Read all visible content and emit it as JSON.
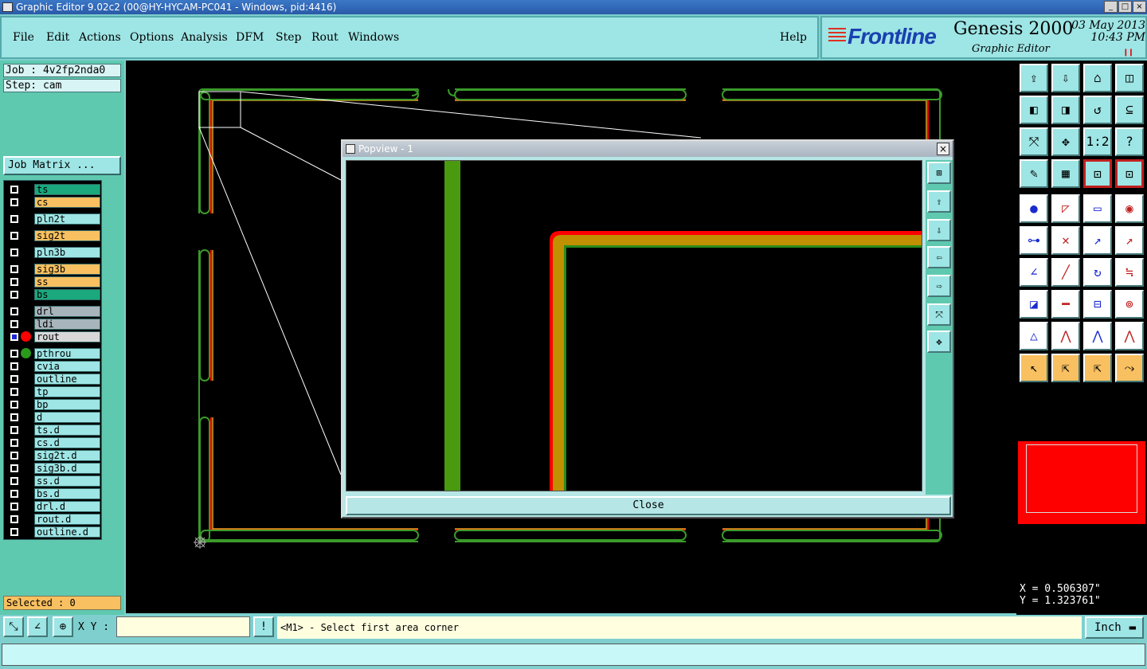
{
  "window": {
    "title": "Graphic Editor 9.02c2 (00@HY-HYCAM-PC041 - Windows, pid:4416)"
  },
  "menu": [
    "File",
    "Edit",
    "Actions",
    "Options",
    "Analysis",
    "DFM",
    "Step",
    "Rout",
    "Windows"
  ],
  "help": "Help",
  "brand": {
    "logo": "Frontline",
    "product": "Genesis 2000",
    "subtitle": "Graphic Editor",
    "date": "03 May 2013",
    "time": "10:43 PM",
    "pause": "❙❙"
  },
  "job": "Job : 4v2fp2nda0",
  "step": "Step: cam",
  "job_matrix": "Job Matrix ...",
  "layers": [
    {
      "name": "ts",
      "color": "#1aa87c"
    },
    {
      "name": "cs",
      "color": "#f8c060"
    },
    {
      "name": "pln2t",
      "color": "#9ee5e5"
    },
    {
      "name": "sig2t",
      "color": "#f8c060"
    },
    {
      "name": "pln3b",
      "color": "#9ee5e5"
    },
    {
      "name": "sig3b",
      "color": "#f8c060"
    },
    {
      "name": "ss",
      "color": "#f8c060"
    },
    {
      "name": "bs",
      "color": "#1aa87c"
    },
    {
      "name": "drl",
      "color": "#a8b4bc"
    },
    {
      "name": "ldi",
      "color": "#a8b4bc"
    },
    {
      "name": "rout",
      "color": "#d8d8d8",
      "dot": "#ff0000",
      "active": true
    },
    {
      "name": "pthrou",
      "color": "#9ee5e5",
      "dot": "#2a9a1a"
    },
    {
      "name": "cvia",
      "color": "#9ee5e5"
    },
    {
      "name": "outline",
      "color": "#9ee5e5"
    },
    {
      "name": "tp",
      "color": "#9ee5e5"
    },
    {
      "name": "bp",
      "color": "#9ee5e5"
    },
    {
      "name": "d",
      "color": "#9ee5e5"
    },
    {
      "name": "ts.d",
      "color": "#9ee5e5"
    },
    {
      "name": "cs.d",
      "color": "#9ee5e5"
    },
    {
      "name": "sig2t.d",
      "color": "#9ee5e5"
    },
    {
      "name": "sig3b.d",
      "color": "#9ee5e5"
    },
    {
      "name": "ss.d",
      "color": "#9ee5e5"
    },
    {
      "name": "bs.d",
      "color": "#9ee5e5"
    },
    {
      "name": "drl.d",
      "color": "#9ee5e5"
    },
    {
      "name": "rout.d",
      "color": "#9ee5e5"
    },
    {
      "name": "outline.d",
      "color": "#9ee5e5"
    }
  ],
  "selected": "Selected : 0",
  "popup": {
    "title": "Popview - 1",
    "close": "Close"
  },
  "coords": {
    "x": "X = 0.506307\"",
    "y": "Y = 1.323761\""
  },
  "xy_label": "X Y :",
  "prompt": "<M1> - Select first area corner",
  "unit": "Inch",
  "tool_icons": [
    "zoom-home-icon",
    "zoom-out-icon",
    "home-icon",
    "window-icon",
    "pan-left-icon",
    "pan-right-icon",
    "undo-icon",
    "redraw-icon",
    "fit-icon",
    "center-icon",
    "scale-1-2-icon",
    "help-icon",
    "measure-tool-icon",
    "grid-icon",
    "snap-icon",
    "snap-red-icon",
    "select-pad-icon",
    "line-draw-icon",
    "ruler-icon",
    "circle-icon",
    "connect-icon",
    "cross-icon",
    "arrow-point-icon",
    "arrow-point2-icon",
    "angle-icon",
    "slope-icon",
    "arc-icon",
    "flip-icon",
    "pad-select-icon",
    "red-line-icon",
    "dimension-icon",
    "blobs-icon",
    "triangle-icon",
    "triangle-a-icon",
    "triangle-b-icon",
    "triangle-c-icon",
    "pointer-icon",
    "pointer-box-icon",
    "pointer-target-icon",
    "route-icon"
  ]
}
